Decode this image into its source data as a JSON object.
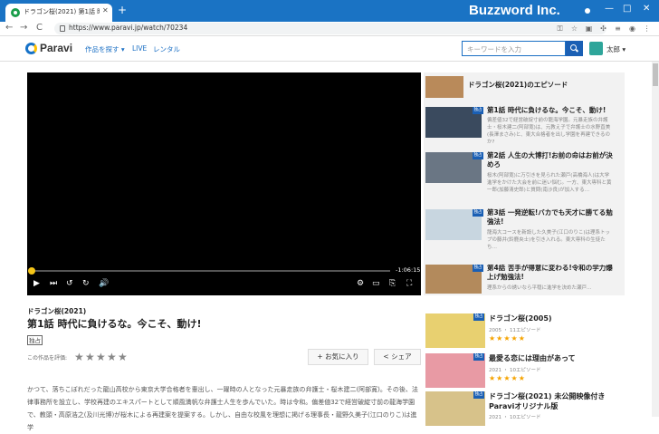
{
  "browser": {
    "tab_title": "ドラゴン桜(2021) 第1話 時代に負け",
    "new_tab": "+",
    "url": "https://www.paravi.jp/watch/70234",
    "brand_overlay": "Buzzword Inc.",
    "window_controls": [
      "—",
      "□",
      "✕"
    ],
    "nav": [
      "←",
      "→",
      "C"
    ],
    "toolbar_icons": [
      "key-icon",
      "star-icon",
      "extension-icon",
      "puzzle-icon",
      "playlist-icon",
      "profile-icon",
      "menu-icon"
    ]
  },
  "header": {
    "logo": "Paravi",
    "nav": [
      "作品を探す ▾",
      "LIVE",
      "レンタル"
    ],
    "search_placeholder": "キーワードを入力",
    "user": "太郎 ▾"
  },
  "player": {
    "time": "-1:06:15",
    "progress": 0.0,
    "controls_left": [
      "▶",
      "⏭",
      "↺",
      "↻",
      "🔊"
    ],
    "controls_right": [
      "⚙",
      "▭",
      "⎘",
      "⛶"
    ]
  },
  "episodes_panel": {
    "title": "ドラゴン桜(2021)のエピソード",
    "badge": "独占",
    "items": [
      {
        "title": "第1話 時代に負けるな。今こそ、動け!",
        "desc": "偏差値32で経営破綻寸前の龍海学園。元暴走族の弁護士・桜木建二(阿部寛)は、元教え子で弁護士の水野直美(長澤まさみ)と、東大合格者を出し学園を再建できるのか?"
      },
      {
        "title": "第2話 人生の大博打!お前の命はお前が決めろ",
        "desc": "桜木(阿部寛)に万引きを見られた瀬戸(高橋海人)は大学進学をかけた大会を前に迷い悩む。一方、東大専科と黄一郎(加藤清史郎)と質問(南沙良)が加入する…"
      },
      {
        "title": "第3話 一発逆転!バカでも天才に勝てる勉強法!",
        "desc": "龍海大コースを新設した久美子(江口のりこ)は理系トップの藤井(鈴鹿央士)を引き入れる。東大専科の生徒たち…"
      },
      {
        "title": "第4話 苦手が得意に変わる!令和の学力爆上げ勉強法!",
        "desc": "理系からの誘いなら平穏に進学を決めた瀬戸…"
      }
    ]
  },
  "episode": {
    "show": "ドラゴン桜(2021)",
    "title": "第1話 時代に負けるな。今こそ、動け!",
    "tag": "独占",
    "rate_label": "この作品を評価:",
    "stars": 5,
    "fav_button": "+ お気に入り",
    "share_button": "< シェア",
    "description": "かつて、落ちこぼれだった龍山高校から東京大学合格者を輩出し、一躍時の人となった元暴走族の弁護士・桜木建二(阿部寛)。その後、法律事務所を設立し、学校再建のエキスパートとして順風満帆な弁護士人生を歩んでいた。時は令和。偏差値32で経営破綻寸前の龍海学園で、教頭・高原浩之(及川光博)が桜木による再建案を提案する。しかし、自由な校風を理想に掲げる理事長・龍野久美子(江口のりこ)は進学"
  },
  "related": [
    {
      "title": "ドラゴン桜(2005)",
      "meta": "2005 ・ 11エピソード",
      "stars": "★★★★★"
    },
    {
      "title": "最愛る恋には理由があって",
      "meta": "2021 ・ 10エピソード",
      "stars": "★★★★★"
    },
    {
      "title": "ドラゴン桜(2021) 未公開映像付きParaviオリジナル版",
      "meta": "2021 ・ 10エピソード",
      "stars": ""
    }
  ],
  "colors": {
    "accent": "#1a6fc4",
    "tabbar": "#1a73c4",
    "star_rated": "#f5a300"
  }
}
